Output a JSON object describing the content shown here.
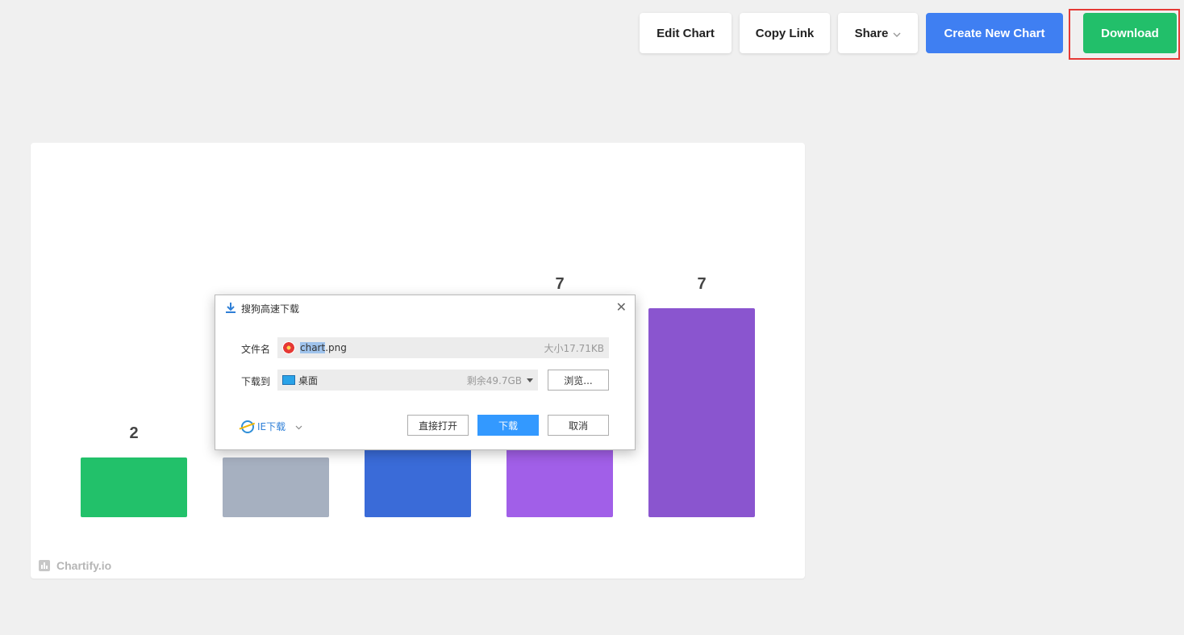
{
  "toolbar": {
    "edit_chart": "Edit Chart",
    "copy_link": "Copy Link",
    "share": "Share",
    "create_new_chart": "Create New Chart",
    "download": "Download"
  },
  "chart_data": {
    "type": "bar",
    "categories": [
      "",
      "",
      "",
      "",
      ""
    ],
    "values": [
      2,
      null,
      null,
      7,
      7
    ],
    "data_labels": [
      "2",
      "",
      "",
      "7",
      "7"
    ],
    "colors": [
      "#22c16a",
      "#a6b0c0",
      "#3a6bd8",
      "#a15fe8",
      "#8a55cf"
    ],
    "watermark": "Chartify.io"
  },
  "dialog": {
    "title": "搜狗高速下载",
    "filename_label": "文件名",
    "filename_highlight": "chart",
    "filename_rest": ".png",
    "file_size": "大小17.71KB",
    "save_to_label": "下载到",
    "save_to_value": "桌面",
    "free_space": "剩余49.7GB",
    "browse": "浏览...",
    "ie_download": "IE下载",
    "open_directly": "直接打开",
    "download": "下载",
    "cancel": "取消"
  }
}
